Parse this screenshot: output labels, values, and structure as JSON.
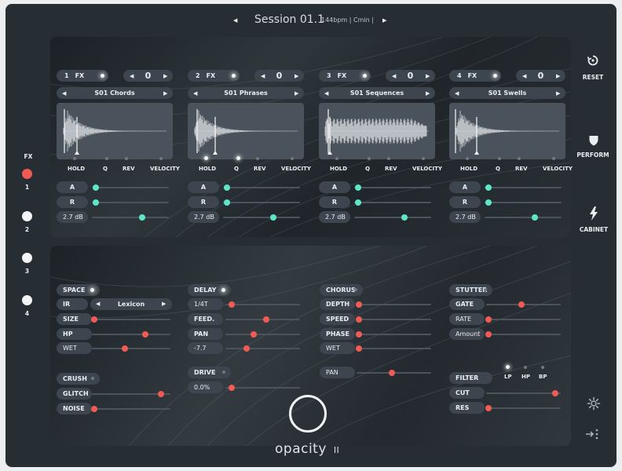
{
  "header": {
    "session": "Session 01.1",
    "meta": "144bpm | Cmin |"
  },
  "sidebar": {
    "title": "FX",
    "items": [
      {
        "label": "1",
        "active": true
      },
      {
        "label": "2"
      },
      {
        "label": "3"
      },
      {
        "label": "4"
      }
    ]
  },
  "right": {
    "reset": "RESET",
    "perform": "PERFORM",
    "cabinet": "CABINET"
  },
  "slots": [
    {
      "num": "1",
      "fx": "FX",
      "value": "0",
      "preset": "S01 Chords",
      "db": "2.7 dB",
      "lit": [
        false,
        false,
        false,
        false
      ]
    },
    {
      "num": "2",
      "fx": "FX",
      "value": "0",
      "preset": "S01 Phrases",
      "db": "2.7 dB",
      "lit": [
        true,
        true,
        false,
        false
      ]
    },
    {
      "num": "3",
      "fx": "FX",
      "value": "0",
      "preset": "S01 Sequences",
      "db": "2.7 dB",
      "lit": [
        false,
        false,
        false,
        false
      ]
    },
    {
      "num": "4",
      "fx": "FX",
      "value": "0",
      "preset": "S01 Swells",
      "db": "2.7 dB",
      "lit": [
        false,
        false,
        false,
        false
      ]
    }
  ],
  "mod_labels": [
    "HOLD",
    "Q",
    "REV",
    "VELOCITY"
  ],
  "env": {
    "a": "A",
    "r": "R"
  },
  "fx": {
    "space": "SPACE",
    "ir": "IR",
    "ir_value": "Lexicon",
    "size": "SIZE",
    "hp": "HP",
    "wet": "WET",
    "delay": "DELAY",
    "delay_time": "1/4T",
    "feed": "FEED.",
    "pan": "PAN",
    "delay_val": "-7.7",
    "chorus": "CHORUS",
    "depth": "DEPTH",
    "speed": "SPEED",
    "phase": "PHASE",
    "chorus_wet": "WET",
    "stutter": "STUTTER",
    "gate": "GATE",
    "rate": "RATE",
    "amount": "Amount",
    "crush": "CRUSH",
    "glitch": "GLITCH",
    "noise": "NOISE",
    "drive": "DRIVE",
    "drive_val": "0.0%",
    "pan2": "PAN",
    "filter": "FILTER",
    "lp": "LP",
    "hp2": "HP",
    "bp": "BP",
    "cut": "CUT",
    "res": "RES"
  },
  "logo": {
    "text": "opacity",
    "suffix": "II"
  },
  "colors": {
    "accent_red": "#f05b55",
    "accent_green": "#5ee6c6",
    "panel": "#3d464e",
    "bg": "#262d33"
  }
}
